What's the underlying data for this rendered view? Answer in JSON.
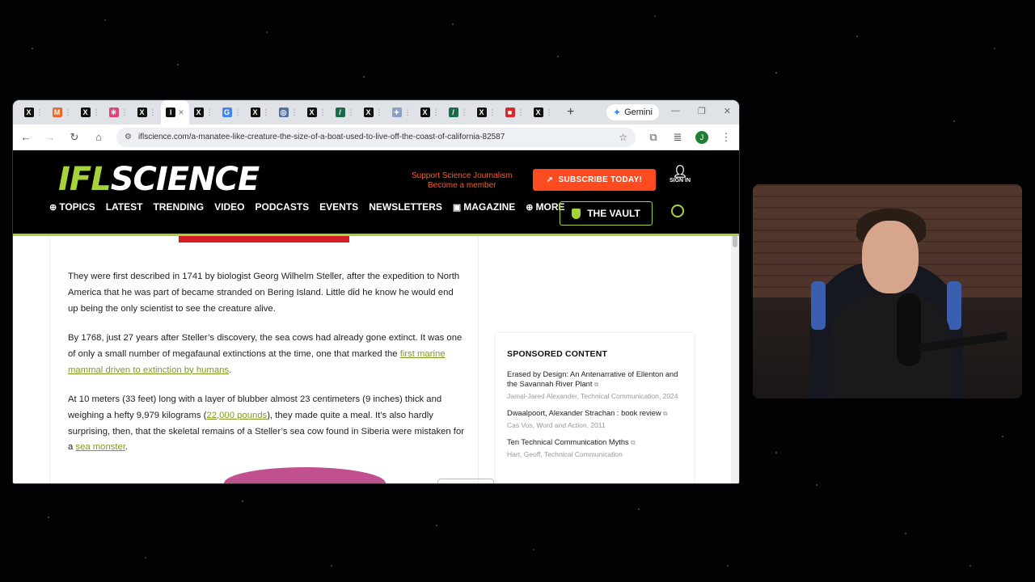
{
  "browser": {
    "tabs": [
      {
        "icon": "x-logo-icon",
        "letter": "X",
        "color": "#111"
      },
      {
        "icon": "orange-square-icon",
        "letter": "M",
        "color": "#e36b2c"
      },
      {
        "icon": "x-logo-icon",
        "letter": "X",
        "color": "#111"
      },
      {
        "icon": "pink-asterisk-icon",
        "letter": "✳",
        "color": "#e0427a"
      },
      {
        "icon": "x-logo-icon",
        "letter": "X",
        "color": "#111"
      },
      {
        "icon": "ifl-favicon-icon",
        "letter": "I",
        "color": "#111",
        "active": true
      },
      {
        "icon": "x-logo-icon",
        "letter": "X",
        "color": "#111"
      },
      {
        "icon": "google-icon",
        "letter": "G",
        "color": "#4285f4"
      },
      {
        "icon": "x-logo-icon",
        "letter": "X",
        "color": "#111"
      },
      {
        "icon": "globe-icon",
        "letter": "◎",
        "color": "#5470a0"
      },
      {
        "icon": "x-logo-icon",
        "letter": "X",
        "color": "#111"
      },
      {
        "icon": "green-circle-icon",
        "letter": "/",
        "color": "#1a6b4a"
      },
      {
        "icon": "x-logo-icon",
        "letter": "X",
        "color": "#111"
      },
      {
        "icon": "bird-icon",
        "letter": "✦",
        "color": "#8aa0c4"
      },
      {
        "icon": "x-logo-icon",
        "letter": "X",
        "color": "#111"
      },
      {
        "icon": "green-circle-icon",
        "letter": "/",
        "color": "#1a6b4a"
      },
      {
        "icon": "x-logo-icon",
        "letter": "X",
        "color": "#111"
      },
      {
        "icon": "red-square-icon",
        "letter": "■",
        "color": "#d8262d"
      },
      {
        "icon": "x-logo-icon",
        "letter": "X",
        "color": "#111"
      }
    ],
    "gemini_label": "Gemini",
    "url": "iflscience.com/a-manatee-like-creature-the-size-of-a-boat-used-to-live-off-the-coast-of-california-82587",
    "profile_initial": "J"
  },
  "site": {
    "logo_ifl": "IFL",
    "logo_science": "SCIENCE",
    "support_line1": "Support Science Journalism",
    "support_line2": "Become a member",
    "subscribe_label": "SUBSCRIBE TODAY!",
    "signin_label": "SIGN IN",
    "nav": [
      {
        "label": "TOPICS",
        "icon": "plus-circle-icon"
      },
      {
        "label": "LATEST"
      },
      {
        "label": "TRENDING"
      },
      {
        "label": "VIDEO"
      },
      {
        "label": "PODCASTS"
      },
      {
        "label": "EVENTS"
      },
      {
        "label": "NEWSLETTERS"
      },
      {
        "label": "MAGAZINE",
        "icon": "book-icon"
      },
      {
        "label": "MORE",
        "icon": "plus-circle-icon"
      }
    ],
    "vault_label": "THE VAULT",
    "brand_color": "#a6d23a",
    "accent_color": "#ff4b1f"
  },
  "article": {
    "p1": "They were first described in 1741 by biologist Georg Wilhelm Steller, after the expedition to North America that he was part of became stranded on Bering Island. Little did he know he would end up being the only scientist to see the creature alive.",
    "p2_before": "By 1768, just 27 years after Steller’s discovery, the sea cows had already gone extinct. It was one of only a small number of megafaunal extinctions at the time, one that marked the ",
    "p2_link": "first marine mammal driven to extinction by humans",
    "p2_after": ".",
    "p3_before": "At 10 meters (33 feet) long with a layer of blubber almost 23 centimeters (9 inches) thick and weighing a hefty 9,979 kilograms (",
    "p3_link1": "22,000 pounds",
    "p3_mid": "), they made quite a meal. It’s also hardly surprising, then, that the skeletal remains of a Steller’s sea cow found in Siberia were mistaken for a ",
    "p3_link2": "sea monster",
    "p3_after": "."
  },
  "sponsored": {
    "title": "SPONSORED CONTENT",
    "items": [
      {
        "headline": "Erased by Design: An Antenarrative of Ellenton and the Savannah River Plant",
        "meta": "Jamal-Jared Alexander, Technical Communication, 2024"
      },
      {
        "headline": "Dwaalpoort, Alexander Strachan : book review",
        "meta": "Cas Vos, Word and Action, 2011"
      },
      {
        "headline": "Ten Technical Communication Myths",
        "meta": "Hart, Geoff, Technical Communication"
      }
    ]
  }
}
